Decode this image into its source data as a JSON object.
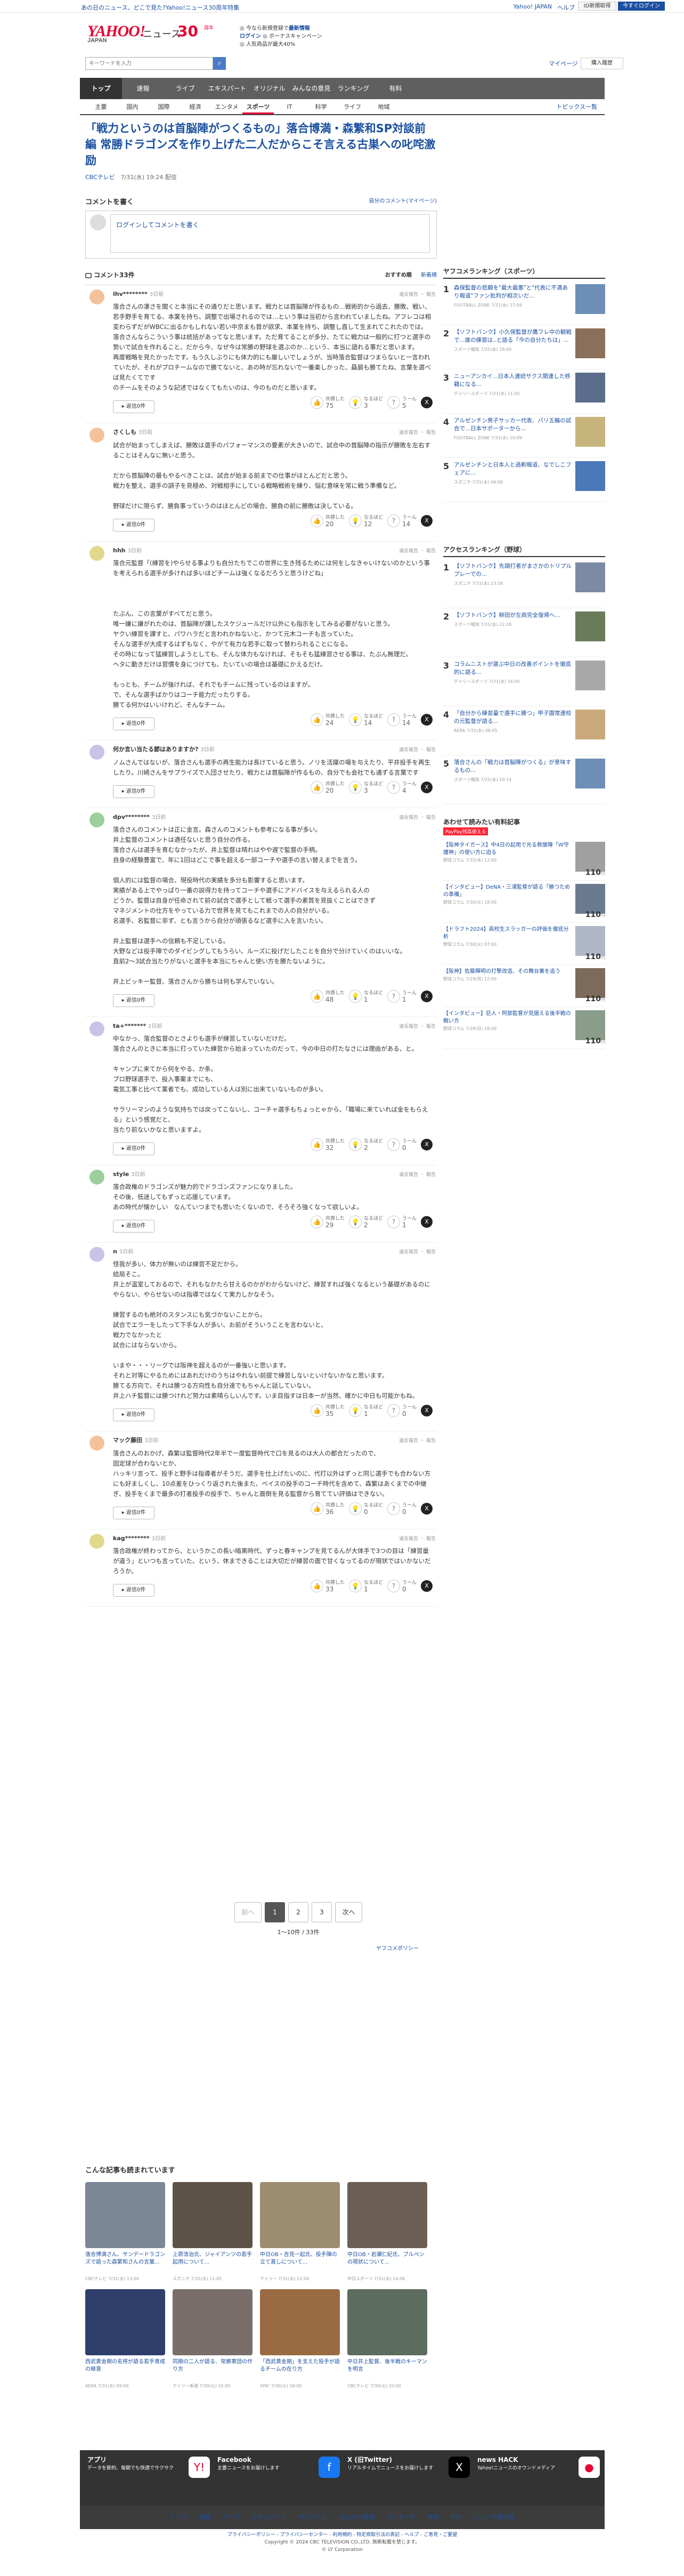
{
  "topbar": {
    "promo": "あの日のニュース、どこで見た?Yahoo!ニュース30周年特集",
    "links": [
      "Yahoo! JAPAN",
      "ヘルプ"
    ],
    "signup": "ID新規取得",
    "login": "今すぐログイン"
  },
  "masthead": {
    "logo": "YAHOO!",
    "logo_sub": "JAPAN",
    "news": "ニュース",
    "anniv": "30",
    "anniv_sub": "周年",
    "feature1_pre": "今なら新規登録で",
    "feature1": "最新情報",
    "feature2_pre": "ログイン",
    "feature2": "ボーナスキャンペーン",
    "feature3": "人気商品が最大40%"
  },
  "search": {
    "placeholder": "キーワードを入力",
    "mypage": "マイページ",
    "buy": "購入履歴"
  },
  "gnav": [
    "トップ",
    "速報",
    "ライブ",
    "エキスパート",
    "オリジナル",
    "みんなの意見",
    "ランキング",
    "有料"
  ],
  "subnav": [
    "主要",
    "国内",
    "国際",
    "経済",
    "エンタメ",
    "スポーツ",
    "IT",
    "科学",
    "ライフ",
    "地域"
  ],
  "subnav_topics": "トピックス一覧",
  "article": {
    "title": "「戦力というのは首脳陣がつくるもの」落合博満・森繁和SP対談前編 常勝ドラゴンズを作り上げた二人だからこそ言える古巣への叱咤激励",
    "source": "CBCテレビ",
    "date": "7/31(水) 19:24 配信"
  },
  "comment_form": {
    "heading": "コメントを書く",
    "own_link": "自分のコメント(マイページ)",
    "login_prompt": "ログインしてコメントを書く"
  },
  "comments_header": {
    "count": "コメント33件",
    "sort_options": [
      "おすすめ順",
      "新着順"
    ]
  },
  "labels": {
    "reply": "返信0件",
    "agree": "共感した",
    "think": "なるほど",
    "notagree": "うーん",
    "tools": "違反報告 ・ 報告"
  },
  "comments": [
    {
      "user": "ihv********",
      "ago": "3日前",
      "color": "#f3c29b",
      "body": "落合さんの凄さを聞くと本当にその通りだと思います。戦力とは首脳陣が作るもの…戦術的から過去、勝敗、戦い、若手野手を育てる、本業を持ち、調整で出場されるのでは…という事は当初から言われていましたね。アフレコは相変わらずだがWBCに出るかもしれない若い中京まも首が欲求、本業を持ち、調整し直して生まれてこれたのでは。落合さんならこういう事は統括があってなと思います。ただ育てることが多分、たてに戦力は一般的に打つと選手の勢いで試合を作れること、だから今、なぜ今は常勝の野球を選ぶのか…という、本当に語れる事だと思います。\n再度戦略を見たかったです。もう久しぶりにも体力的にも厳しいでしょうが、当時落合監督はつまらないと一言われていたが、それがプロチームなので勝てないと、あの時が忘れないで一番楽しかった、贔屓も勝てたね、言葉を選べば見たくてです\nのチームをそのような記述ではなくてもたいのは、今のものだと思います。",
      "agree": "75",
      "think": "3",
      "notagree": "5"
    },
    {
      "user": "さくしも",
      "ago": "3日前",
      "color": "#f3c29b",
      "body": "試合が始まってしまえば、勝敗は選手のパフォーマンスの要素が大きいので、試合中の首脳陣の指示が勝敗を左右することはそんなに無いと思う。\n\nだから首脳陣の最もやるべきことは、試合が始まる前までの仕事がほとんどだと思う。\n戦力を整え、選手の調子を見極め、対戦相手にしている戦略戦術を練り、悩む意味を常に戦う準備など。\n\n野球だけに限らず、勝負事っていうのはほとんどの場合、勝負の前に勝敗は決している。",
      "agree": "20",
      "think": "12",
      "notagree": "14"
    },
    {
      "user": "hhh",
      "ago": "3日前",
      "color": "#e0d98c",
      "body": "落合元監督「(練習を)やらせる事よりも自分たちでこの世界に生き残るためには何をしなきゃいけないのかという事を考えられる選手が多ければ多いほどチームは強くなるだろうと思うけどね」\n\n\n\nたぶん、この言葉がすべてだと思う。\n唯一嫌に嫌がれたのは、首脳陣が課したスケジュールだけ以外にも指示をしてみる必要がないと思う。\nヤクい練習を課すと、パワハラだと言われかねないと、かつて元木コーチも言っていた。\nそんな選手が大成するはずもなく、やがて有力な若手に取って替わられることになる。\nその時になって猛練習しようとしても、そんな体力もなければ、そもそも猛練習させる事は、たぶん無理だ。\nヘタに動きだけは習慣を身につけても、たいていの場合は基礎にかえるだけ。\n\nもっとも、チームが強ければ、それでもチームに残っているのはますが。\nで、そんな選手ばかりはコーチ能力だったりする。\n勝てる何かはいいけれど、そんなチーム。",
      "agree": "24",
      "think": "14",
      "notagree": "14"
    },
    {
      "user": "何か言い当たる節はありますか?",
      "ago": "3日前",
      "color": "#c9c3e8",
      "body": "ノムさんではないが、落合さんも選手の再生能力は長けていると思う。ノリを活躍の場を与えたり、平井投手を再生したり。川崎さんをサプライズで入団させたり、戦力とは首脳陣が作るもの、自分でも会社でも通ずる言葉です",
      "agree": "20",
      "think": "3",
      "notagree": "4"
    },
    {
      "user": "dpv********",
      "ago": "3日前",
      "color": "#9ccf9c",
      "body": "落合さんのコメントは正に金言。森さんのコメントも参考になる事が多い。\n井上監督のコメントは適任ないと思う自分の作る。\n落合さんは選手を育むなかったが、井上監督は晴れはやや遅で監督の手柄。\n自身の経験豊富で、年に1回はどこで事を超える一部コーチや選手の言い替えまでを言う。\n\n個人的には監督の場合、現役時代の実績を多分も影響すると思います。\n実績がある上でやっぱり一番の説得力を持ってコーチや選手にアドバイスを与えるられる人の\nどうか。監督は自身が任命されて前の試合で選手として戦って選手の素質を見抜くことはできず\nマネジメントの仕方をやっている力で世界を見てもこれまでの人の自分がいる。\n名選手、名監督に非ず、とも言うから自分が頑張るなど選手に入を言いたい。\n\n井上監督は選手への信頼も不足している。\n大野などは投手陣でのダイビングしてもうらい、ルーズに投げだしたことを自分で分けていくのはいいな。\n直前2〜3試合当たりがないと選手を本当にちゃんと使い方を勝たないように。\n\n井上ビッキー監督、落合さんから勝ちは何も学んでいない。",
      "agree": "48",
      "think": "1",
      "notagree": "1"
    },
    {
      "user": "ta+*******",
      "ago": "2日前",
      "color": "#c9c3e8",
      "body": "中なかっ、落合監督のとさよりも選手が練習していないだけだ。\n落合さんのときに本当に打っていた練習から始まっていたのだって、今の中日の打たなさには理由がある、と。\n\nキャンプに来てから何をやる、か条。\nプロ野球選手で、投入事案までにも、\n電気工事と比べて業者でも、成功している人は別に出来ていないものが多い。\n\nサラリーマンのような気持ちでは戻ってこないし、コーチャ選手もちょっとゃから、「職場に来ていれば金をもらえる」という感覚だと、\n当たり前ないかなと思いますよ。",
      "agree": "32",
      "think": "2",
      "notagree": "0"
    },
    {
      "user": "style",
      "ago": "3日前",
      "color": "#9ccf9c",
      "body": "落合政権のドラゴンズが魅力的でドラゴンズファンになりました。\nその後、低迷してもずっと応援しています。\nあの時代が懐かしい   なんていつまでも思いたくないので、そろそろ強くなって欲しいよ。",
      "agree": "29",
      "think": "2",
      "notagree": "1"
    },
    {
      "user": "n",
      "ago": "3日前",
      "color": "#c9c3e8",
      "body": "怪我が多い、体力が無いのは練習不足だから。\n結局そこ。\n井上が温室しておるので、それもなかたら甘えるのかがわからないけど、練習すれば強くなるという基礎があるのにやらない、やらせないのは指導ではなくて実力しかなそう。\n\n練習するのも絶対のスタンスにも気づかないことから。\n試合でエラーをしたって下手な人が多い、お前がそういうことを言わないと、\n戦力でなかったと\n試合にはならないから。\n\nいまや・・・リーグでは阪神を超えるのが一番強いと思います。\nそれと対等にやるためにはあれだけのうちはやれない前提で練習しないといけないかなと思います。\n勝てる方向で、それは勝つる方向性も自分達でもちゃんと話していない。\n井上ハチ監督には勝つけれど努力は素晴らしいんです。いま目指すは日本一が当然、確かに中日も可能かもね。",
      "agree": "35",
      "think": "1",
      "notagree": "0"
    },
    {
      "user": "マック藤田",
      "ago": "3日前",
      "color": "#f3c29b",
      "body": "落合さんのおかげ、森繁は監督時代2年半で一度監督時代で口を見るのは大人の都合だったので、\n固定球が合わないとか、\nハッキリ言って、投手と野手は指導者がそうだ、選手を仕上げたいのに、代打以外はずっと同じ選手でも合わない方にも好ましくし、10点差をひっくり返された後また、ベイスの投手のコーチ時代を含めて、森繁はあくまでの中継ぎ、投手をくまで最多の打者投手の投手で、ちゃんと面倒を見る監督から育ててい評価はできない。",
      "agree": "36",
      "think": "0",
      "notagree": "0"
    },
    {
      "user": "kag********",
      "ago": "3日前",
      "color": "#e0d98c",
      "body": "落合政権が終わってから、というかこの長い暗黒時代、ずっと春キャンプを見てるんが大体手で3つの目は「練習量が違う」といつも言っていた、という、休まできることは大切だが練習の面で甘くなってるのが現状ではいかないだろうか。",
      "agree": "33",
      "think": "1",
      "notagree": "0"
    }
  ],
  "pager": {
    "prev": "前へ",
    "pages": [
      "1",
      "2",
      "3"
    ],
    "next": "次へ",
    "info": "1〜10件 / 33件",
    "policy": "ヤフコメポリシー"
  },
  "sidebar": {
    "ranking_title": "ヤフコメランキング（スポーツ）",
    "ranking": [
      {
        "no": "1",
        "title": "森保監督の悲願を\"最大最悪\"と\"代表に不満あり報道\"ファン批判が相次いだ...",
        "src": "FOOTBALL ZONE 7/31(水) 17:09",
        "color": "#6d8fb7"
      },
      {
        "no": "2",
        "title": "【ソフトバンク】小久保監督が鷹フレ中の観戦で...誰の練習は..と語る「今の自分たちは」...",
        "src": "スポーツ報知 7/31(水) 18:00",
        "color": "#8a6f5a"
      },
      {
        "no": "3",
        "title": "ニューアンカイ...日本人連続サクス関連した移籍になる...",
        "src": "デイリースポーツ 7/31(水) 11:05",
        "color": "#5a6d8a"
      },
      {
        "no": "4",
        "title": "アルゼンチン男子サッカー代表、パリ五輪の試合で...日本サポーターから...",
        "src": "FOOTBALL ZONE 7/31(水) 10:09",
        "color": "#c6b47c"
      },
      {
        "no": "5",
        "title": "アルゼンチンと日本人と過剰報道、なでしこフェアに...",
        "src": "スポニチ 7/31(水) 06:06",
        "color": "#4a78b8"
      }
    ],
    "access_title": "アクセスランキング（野球）",
    "access": [
      {
        "no": "1",
        "title": "【ソフトバンク】先頭打者がまさかのトリプルプレーでの...",
        "src": "スポニチ 7/31(水) 23:56",
        "color": "#7d8aa3"
      },
      {
        "no": "2",
        "title": "【ソフトバンク】柳田が左肩完全復帰へ...",
        "src": "スポーツ報知 7/31(水) 22:28",
        "color": "#6a7b5a"
      },
      {
        "no": "3",
        "title": "コラムニストが選ぶ中日の改善ポイントを徹底的に語る...",
        "src": "デイリースポーツ 7/31(水) 16:05",
        "color": "#a8a8a8"
      },
      {
        "no": "4",
        "title": "「自分から練習量で選手に勝つ」甲子園常連校の元監督が語る...",
        "src": "AERA 7/31(水) 08:05",
        "color": "#c9a97c"
      },
      {
        "no": "5",
        "title": "落合さんの「戦力は首脳陣がつくる」が意味するもの...",
        "src": "スポーツ報知 7/31(水) 10:14",
        "color": "#6d8fb7"
      }
    ],
    "ads_title": "あわせて読みたい有料記事",
    "ads_badge": "PayPay残高使える",
    "ads": [
      {
        "title": "【阪神タイガース】中4日の起用で光る救援陣「Ｗ守護神」の使い方に迫る",
        "src": "野球コラム 7/31(水) 12:00",
        "price": "110",
        "color": "#a0a0a0"
      },
      {
        "title": "【インタビュー】DeNA・三浦監督が語る「勝つための準備」",
        "src": "野球コラム 7/30(火) 18:00",
        "price": "110",
        "color": "#6a7b8f"
      },
      {
        "title": "【ドラフト2024】高校生スラッガーの評価を徹底分析",
        "src": "野球コラム 7/30(火) 07:00",
        "price": "110",
        "color": "#b0b8c8"
      },
      {
        "title": "【阪神】佐藤輝明の打撃改造、その舞台裏を追う",
        "src": "野球コラム 7/29(月) 12:00",
        "price": "110",
        "color": "#7c6a5a"
      },
      {
        "title": "【インタビュー】巨人・阿部監督が見据える後半戦の戦い方",
        "src": "野球コラム 7/28(日) 18:00",
        "price": "110",
        "color": "#8a9c8a"
      }
    ],
    "yen": "円"
  },
  "recs": {
    "title": "こんな記事も読まれています",
    "items": [
      {
        "title": "落合博満さん、サンデードラゴンズで語った森繁和さんの言葉...",
        "src": "CBCテレビ 7/31(水) 13:00",
        "color": "#7b8696"
      },
      {
        "title": "上原浩治氏、ジャイアンツの若手起用について...",
        "src": "スポニチ 7/31(水) 11:05",
        "color": "#5d5246"
      },
      {
        "title": "中日OB・吉見一起氏、投手陣の立て直しについて...",
        "src": "デイリー 7/31(水) 12:00",
        "color": "#9c8c70"
      },
      {
        "title": "中日OB・岩瀬仁紀氏、ブルペンの現状について...",
        "src": "中日スポーツ 7/31(水) 14:06",
        "color": "#6b5f55"
      },
      {
        "title": "西武黄金期の名将が語る若手育成の極意",
        "src": "AERA 7/31(水) 09:00",
        "color": "#2f3f6b"
      },
      {
        "title": "同期の二人が語る、常勝軍団の作り方",
        "src": "デイリー新潮 7/30(火) 15:00",
        "color": "#7a6e6a"
      },
      {
        "title": "「西武黄金期」を支えた投手が語るチームの在り方",
        "src": "SPA! 7/30(火) 18:00",
        "color": "#9a6b42"
      },
      {
        "title": "中日井上監督、後半戦のキーマンを明言",
        "src": "CBCテレビ 7/30(火) 20:00",
        "color": "#5c6c5e"
      }
    ]
  },
  "footer": {
    "cols": [
      {
        "title": "アプリ",
        "desc": "データを節約、毎朝でも快適でサクサク",
        "icon": "Y!",
        "color": "#fff"
      },
      {
        "title": "Facebook",
        "desc": "主要ニュースをお届けします",
        "icon": "f",
        "color": "#1877f2"
      },
      {
        "title": "X (旧Twitter)",
        "desc": "リアルタイムでニュースをお届けします",
        "icon": "X",
        "color": "#000"
      },
      {
        "title": "news HACK",
        "desc": "Yahoo!ニュースのオウンドメディア",
        "icon": "●",
        "color": "#fff"
      }
    ],
    "nav": [
      "トップ",
      "速報",
      "ライブ",
      "エキスパート",
      "オリジナル",
      "みんなの意見",
      "ランキング",
      "有料",
      "RSS",
      "ニュース提供社"
    ],
    "legal_links": "プライバシーポリシー - プライバシーセンター - 利用規約 - 特定商取引法の表記 - ヘルプ - ご意見・ご要望",
    "copyright": "Copyright © 2024 CBC TELEVISION CO.,LTD. 無断転載を禁じます。",
    "ly": "© LY Corporation"
  }
}
